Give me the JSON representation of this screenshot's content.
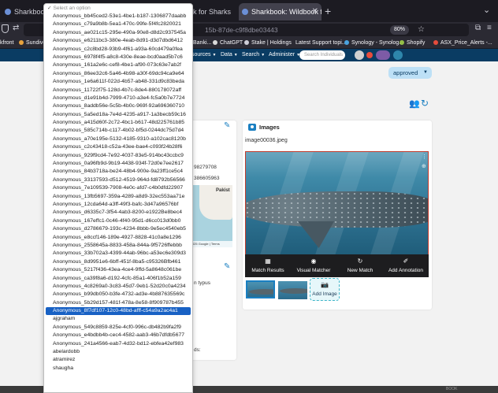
{
  "browser": {
    "tabs": [
      {
        "title": "Sharkbook: Wildbook for Sh",
        "active": false
      },
      {
        "title": "ook for Sharks",
        "active": false
      },
      {
        "title": "Sharkbook: Wildbook for Sharks",
        "active": true
      }
    ],
    "url_fragment": "15b-87de-c9f8dbe03443",
    "zoom": "80%",
    "bookmarks": [
      "kfront",
      "Sundive",
      "Banki...",
      "ChatGPT",
      "Stake | Holdings",
      "Latest Support topi...",
      "Synology - Synolog...",
      "Shopify",
      "ASX_Price_Alerts -..."
    ]
  },
  "site_nav": {
    "items": [
      "sources",
      "Data",
      "Search",
      "Administer"
    ],
    "search_placeholder": "Search Individuals"
  },
  "status": {
    "value": "approved",
    "color": "#bde0f6"
  },
  "left_card": {
    "fragment_1": "98279708",
    "fragment_2": "386605963",
    "map_label": "Pakist",
    "map_attribution": "Map data ©2025 Google | Terms",
    "fragment_3": "n typus",
    "fragment_4": "ds:"
  },
  "images_card": {
    "title": "Images",
    "filename": "image00036.jpeg",
    "actions": [
      {
        "label": "Match Results",
        "icon": "grid-icon"
      },
      {
        "label": "Visual Matcher",
        "icon": "eye-icon"
      },
      {
        "label": "New Match",
        "icon": "refresh-icon"
      },
      {
        "label": "Add Annotation",
        "icon": "annotate-icon"
      }
    ],
    "add_image_label": "Add Image"
  },
  "footer": {
    "text": "BOOK"
  },
  "dropdown": {
    "placeholder": "Select an option",
    "selected_index": 36,
    "options": [
      "Anonymous_bb45ced2-53e1-4be1-b187-1306877daabb",
      "Anonymous_c79a9b8b-5ea1-470c-99fe-5f4fc2820021",
      "Anonymous_ae021c15-295e-490a-90e8-d8d2c937545a",
      "Anonymous_e6211bc3-380e-4eab-8d91-d3d7dbd6412",
      "Anonymous_c2c8bd28-93b9-4f61-a93a-60cd479a0fea",
      "Anonymous_6978f4f5-a8c8-430e-8eae-bcd0aad5b7c6",
      "Anonymous_161a2e6c-cef8-4be1-af90-073c63e7ab2f",
      "Anonymous_86ee32c6-5a46-4b98-a30f-69dc94ca9e64",
      "Anonymous_1e6a611f-022d-4b57-ab48-331d9c83beda",
      "Anonymous_11722f75-128d-4b7c-8de4-880178072aff",
      "Anonymous_d1e91b4d-7999-4710-a3e4-fc5a0b7e7724",
      "Anonymous_8addb56e-5c5b-4b0c-969f-92a696360710",
      "Anonymous_5a5ed18a-7e4d-4235-a917-1a3becb59c16",
      "Anonymous_a415d60f-2c72-4bc1-b617-48d225761b85",
      "Anonymous_585c714b-c117-4b02-bf5d-0244dc75d7d4",
      "Anonymous_a70e195e-5132-4185-9310-a102cac8120b",
      "Anonymous_c2c43418-c52a-43ee-bae4-c093f24b28f6",
      "Anonymous_929f9cd4-7e92-4037-83e5-914bc43ccbc9",
      "Anonymous_0a96fb9d-9b19-4438-934f-72d0e7ee2617",
      "Anonymous_84b3718a-be24-48b4-900e-9a23ff1ce5c4",
      "Anonymous_33137593-d512-4519-964d-fd8792b56566",
      "Anonymous_7e109539-7908-4e0c-afd7-c4b0dfd22907",
      "Anonymous_13fb5697-359a-4289-a8d9-32ec553aa71e",
      "Anonymous_12cda64d-a3ff-49f3-bafc-3d47a96576bf",
      "Anonymous_d6335c7-3f54-4ab3-8200-e1922Be8bec4",
      "Anonymous_167effc1-0c46-4f40-95d1-d6cc013d0bb0",
      "Anonymous_d2786679-193c-4234-8bbb-9e5ec4540eb5",
      "Anonymous_e8ccf146-189e-4927-8828-41c0a8e1296",
      "Anonymous_2558645a-8833-458a-844a-9f5726ffebbb",
      "Anonymous_33b702a3-4399-44ab-96bc-a53ec6e309d3",
      "Anonymous_8d9951e6-6bff-451f-8ba5-c95326Bfb461",
      "Anonymous_5217f436-43ea-4ce4-9ffd-5a8648c061be",
      "Anonymous_ca39f8a6-d192-4cfc-85a1-406f1b52a159",
      "Anonymous_4c8269a0-3c83-45d7-9eb1-52d20c0a4234",
      "Anonymous_b99db050-b3fe-4732-ad3e-4b887635569c",
      "Anonymous_5b29d157-481f-478a-8e58-8f909787b455",
      "Anonymous_8f7df107-12c0-48bd-afff-c54a9a2ac4a1",
      "ajgraham",
      "Anonymous_549c8859-825e-4cf0-996c-db482b9fa2f9",
      "Anonymous_e4bdbb4b-cec4-4582-aab3-46b7dfdb5677",
      "Anonymous_241a4566-eab7-4d32-bd12-ebfea42ef983",
      "abelardobb",
      "atramirez",
      "shaugha"
    ]
  }
}
